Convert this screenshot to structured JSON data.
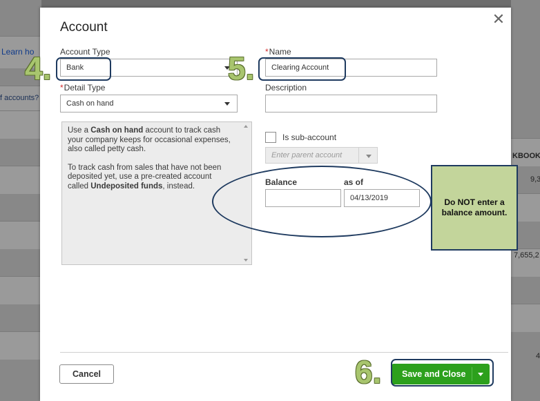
{
  "background": {
    "left_link": "Learn ho",
    "left_text": "f accounts?",
    "right_header": "KBOOKS",
    "right_value_1": "9,3",
    "right_value_2": "7,655,2",
    "right_value_3": "4"
  },
  "dialog": {
    "title": "Account",
    "account_type_label": "Account Type",
    "account_type_value": "Bank",
    "name_label": "Name",
    "name_value": "Clearing Account",
    "detail_type_label": "Detail Type",
    "detail_type_value": "Cash on hand",
    "description_label": "Description",
    "description_value": "",
    "info": {
      "p1_a": "Use a ",
      "p1_b": "Cash on hand",
      "p1_c": " account to track cash your company keeps for occasional expenses, also called petty cash.",
      "p2_a": "To track cash from sales that have not been deposited yet, use a pre-created account called ",
      "p2_b": "Undeposited funds",
      "p2_c": ", instead."
    },
    "sub_account_label": "Is sub-account",
    "parent_account_placeholder": "Enter parent account",
    "balance_label": "Balance",
    "balance_value": "",
    "as_of_label": "as of",
    "as_of_value": "04/13/2019",
    "cancel_label": "Cancel",
    "save_label": "Save and Close",
    "required_mark": "*"
  },
  "annotations": {
    "step4": "4.",
    "step5": "5.",
    "step6": "6.",
    "note": "Do NOT enter a balance amount."
  },
  "colors": {
    "primary_green": "#2ca01c",
    "annotation_green": "#a8c56e",
    "note_fill": "#c3d59b",
    "annotation_outline": "#1e3a5f"
  }
}
